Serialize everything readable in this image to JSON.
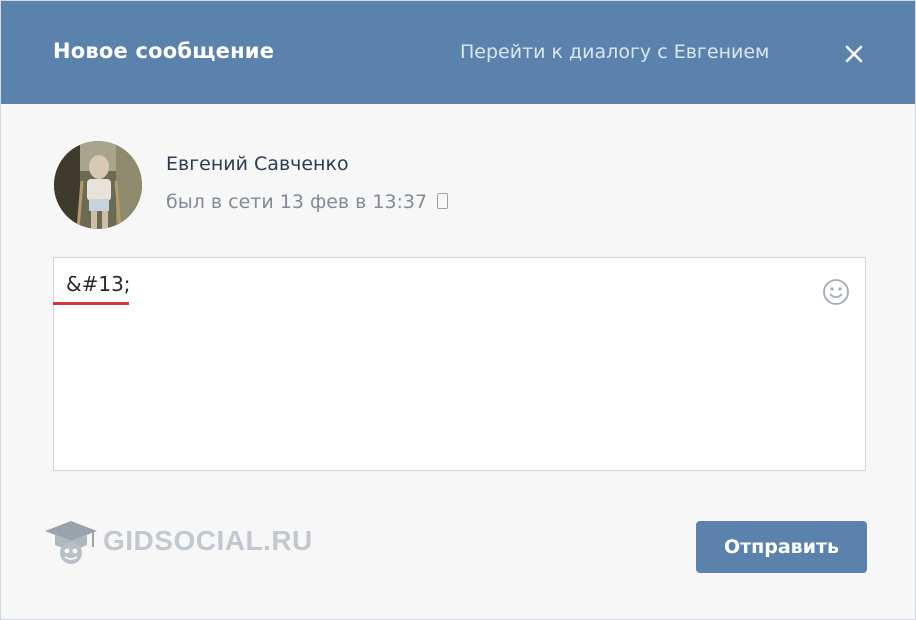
{
  "header": {
    "title": "Новое сообщение",
    "goto_dialog_link": "Перейти к диалогу с Евгением",
    "close_icon": "close-icon"
  },
  "user": {
    "name": "Евгений Савченко",
    "status": "был в сети 13 фев в 13:37",
    "device_icon": "mobile-phone-icon",
    "avatar": "user-avatar-photo"
  },
  "composer": {
    "message_text": "&#13;",
    "emoji_icon": "smile-icon",
    "spellcheck_marker": "red-underline"
  },
  "footer": {
    "send_label": "Отправить",
    "watermark": "GIDSOCIAL.RU"
  },
  "colors": {
    "header_bg": "#5b82ad",
    "button_bg": "#5b82ad",
    "dialog_bg": "#f7f7f7",
    "name_color": "#2b3c52",
    "status_color": "#828b95",
    "spellcheck_red": "#d9343a"
  }
}
